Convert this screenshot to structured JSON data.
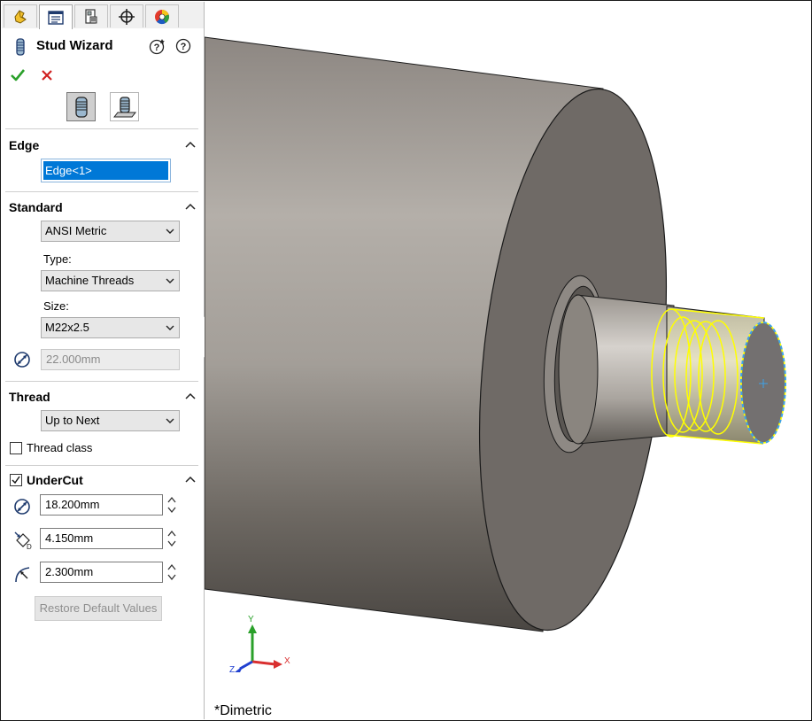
{
  "tabs": [
    {
      "name": "featuremanager-tab",
      "icon": "featuremanager-icon"
    },
    {
      "name": "propertymanager-tab",
      "icon": "propertymanager-icon",
      "active": true
    },
    {
      "name": "configurationmanager-tab",
      "icon": "configurationmanager-icon"
    },
    {
      "name": "dimxpert-tab",
      "icon": "dimxpert-icon"
    },
    {
      "name": "display-manager-tab",
      "icon": "display-manager-icon"
    }
  ],
  "panel": {
    "title": "Stud Wizard",
    "ok_icon": "green-check-icon",
    "cancel_icon": "red-x-icon"
  },
  "stud_types": [
    "stud-on-edge-icon",
    "stud-on-surface-icon"
  ],
  "edge": {
    "title": "Edge",
    "selection": "Edge<1>"
  },
  "standard": {
    "title": "Standard",
    "standard_value": "ANSI Metric",
    "type_label": "Type:",
    "type_value": "Machine Threads",
    "size_label": "Size:",
    "size_value": "M22x2.5",
    "diameter_value": "22.000mm"
  },
  "thread": {
    "title": "Thread",
    "end_condition": "Up to Next",
    "thread_class_label": "Thread class",
    "thread_class_checked": false
  },
  "undercut": {
    "title": "UnderCut",
    "checked": true,
    "diameter": "18.200mm",
    "depth": "4.150mm",
    "radius": "2.300mm",
    "restore_label": "Restore Default Values"
  },
  "viewport": {
    "view_name": "*Dimetric",
    "axes": {
      "x": "X",
      "y": "Y",
      "z": "Z"
    }
  },
  "colors": {
    "accent": "#0078d7",
    "thread_highlight": "#ffff00",
    "selection_edge": "#3ea2e8",
    "ok": "#2aa02a",
    "cancel": "#d02020",
    "axis_x": "#d93030",
    "axis_y": "#2aa02a",
    "axis_z": "#2040d0"
  }
}
